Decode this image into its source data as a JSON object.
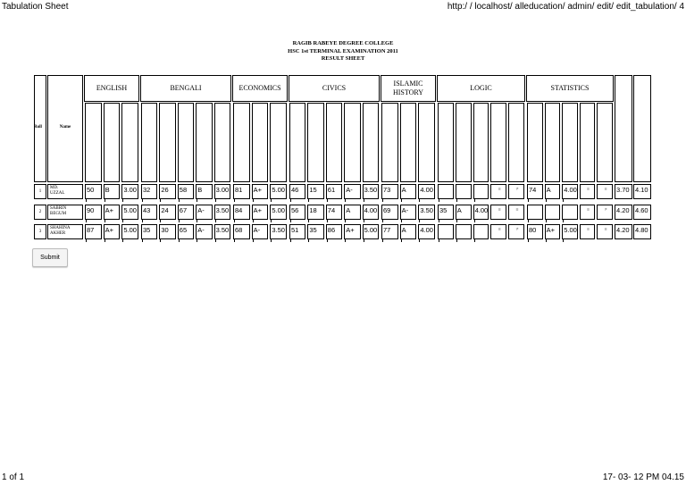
{
  "browser": {
    "page_title": "Tabulation  Sheet",
    "url": "http:/ / localhost/ alleducation/ admin/ edit/ edit_tabulation/ 4",
    "page_count": "1  of  1",
    "timestamp": "17- 03- 12  PM  04.15"
  },
  "header": {
    "college": "RAGIB RABEYE DEGREE COLLEGE",
    "exam": "HSC 1st TERMINAL EXAMINATION 2011",
    "sheet": "RESULT SHEET"
  },
  "table": {
    "roll_label": "Roll",
    "name_label": "Name",
    "subjects": [
      "ENGLISH",
      "BENGALI",
      "ECONOMICS",
      "CIVICS",
      "ISLAMIC HISTORY",
      "LOGIC",
      "STATISTICS"
    ],
    "rows": [
      {
        "roll": "1",
        "name": [
          "MD.",
          "UZZAL"
        ],
        "english": [
          "50",
          "B",
          "3.00"
        ],
        "bengali": [
          "32",
          "26",
          "58",
          "B",
          "3.00"
        ],
        "economics": [
          "81",
          "A+",
          "5.00"
        ],
        "civics": [
          "46",
          "15",
          "61",
          "A-",
          "3.50"
        ],
        "islamic_history": [
          "73",
          "A",
          "4.00"
        ],
        "logic": [
          "",
          "",
          "",
          "≡",
          "≠"
        ],
        "statistics": [
          "74",
          "A",
          "4.00",
          "≡",
          "≡"
        ],
        "totals": [
          "3.70",
          "4.10"
        ]
      },
      {
        "roll": "2",
        "name": [
          "SABRIN",
          "BEGUM"
        ],
        "english": [
          "90",
          "A+",
          "5.00"
        ],
        "bengali": [
          "43",
          "24",
          "67",
          "A-",
          "3.50"
        ],
        "economics": [
          "84",
          "A+",
          "5.00"
        ],
        "civics": [
          "56",
          "18",
          "74",
          "A",
          "4.00"
        ],
        "islamic_history": [
          "69",
          "A-",
          "3.50"
        ],
        "logic": [
          "35",
          "A",
          "4.00",
          "≡",
          "≡"
        ],
        "statistics": [
          "",
          "",
          "",
          "≡",
          "≠"
        ],
        "totals": [
          "4.20",
          "4.60"
        ]
      },
      {
        "roll": "3",
        "name": [
          "SHAHINA",
          "AKHER"
        ],
        "english": [
          "87",
          "A+",
          "5.00"
        ],
        "bengali": [
          "35",
          "30",
          "65",
          "A-",
          "3.50"
        ],
        "economics": [
          "68",
          "A-",
          "3.50"
        ],
        "civics": [
          "51",
          "35",
          "86",
          "A+",
          "5.00"
        ],
        "islamic_history": [
          "77",
          "A",
          "4.00"
        ],
        "logic": [
          "",
          "",
          "",
          "≡",
          "≠"
        ],
        "statistics": [
          "80",
          "A+",
          "5.00",
          "≡",
          "≡"
        ],
        "totals": [
          "4.20",
          "4.80"
        ]
      }
    ]
  },
  "submit_label": "Submit"
}
